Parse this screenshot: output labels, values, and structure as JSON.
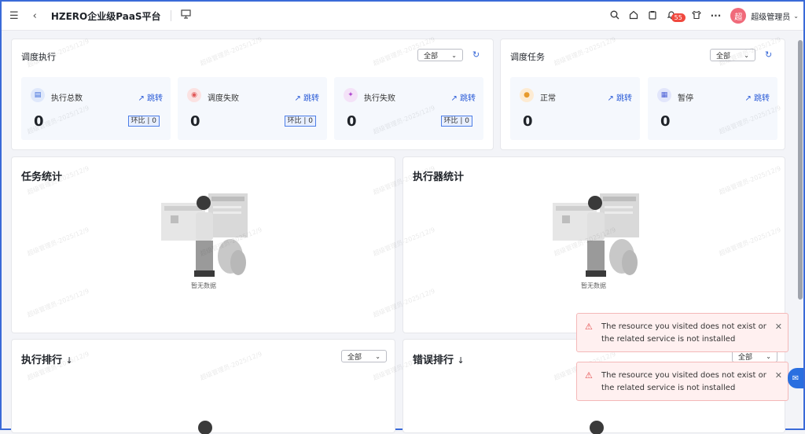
{
  "header": {
    "title": "HZERO企业级PaaS平台",
    "notification_count": "55",
    "avatar_text": "超",
    "username": "超级管理员",
    "more_label": "···"
  },
  "schedule_exec": {
    "title": "调度执行",
    "filter_value": "全部",
    "stats": [
      {
        "label": "执行总数",
        "value": "0",
        "jump": "跳转",
        "ratio": "环比 | 0"
      },
      {
        "label": "调度失败",
        "value": "0",
        "jump": "跳转",
        "ratio": "环比 | 0"
      },
      {
        "label": "执行失败",
        "value": "0",
        "jump": "跳转",
        "ratio": "环比 | 0"
      }
    ]
  },
  "schedule_task": {
    "title": "调度任务",
    "filter_value": "全部",
    "stats": [
      {
        "label": "正常",
        "value": "0",
        "jump": "跳转"
      },
      {
        "label": "暂停",
        "value": "0",
        "jump": "跳转"
      }
    ]
  },
  "task_stats": {
    "title": "任务统计",
    "empty_text": "暂无数据"
  },
  "executor_stats": {
    "title": "执行器统计",
    "empty_text": "暂无数据"
  },
  "exec_rank": {
    "title": "执行排行",
    "sort_icon": "↓",
    "filter_value": "全部"
  },
  "error_rank": {
    "title": "错误排行",
    "sort_icon": "↓",
    "filter_value": "全部"
  },
  "watermark_text": "超级管理员-2025/12/9",
  "toasts": [
    {
      "message": "The resource you visited does not exist or the related service is not installed"
    },
    {
      "message": "The resource you visited does not exist or the related service is not installed"
    }
  ]
}
